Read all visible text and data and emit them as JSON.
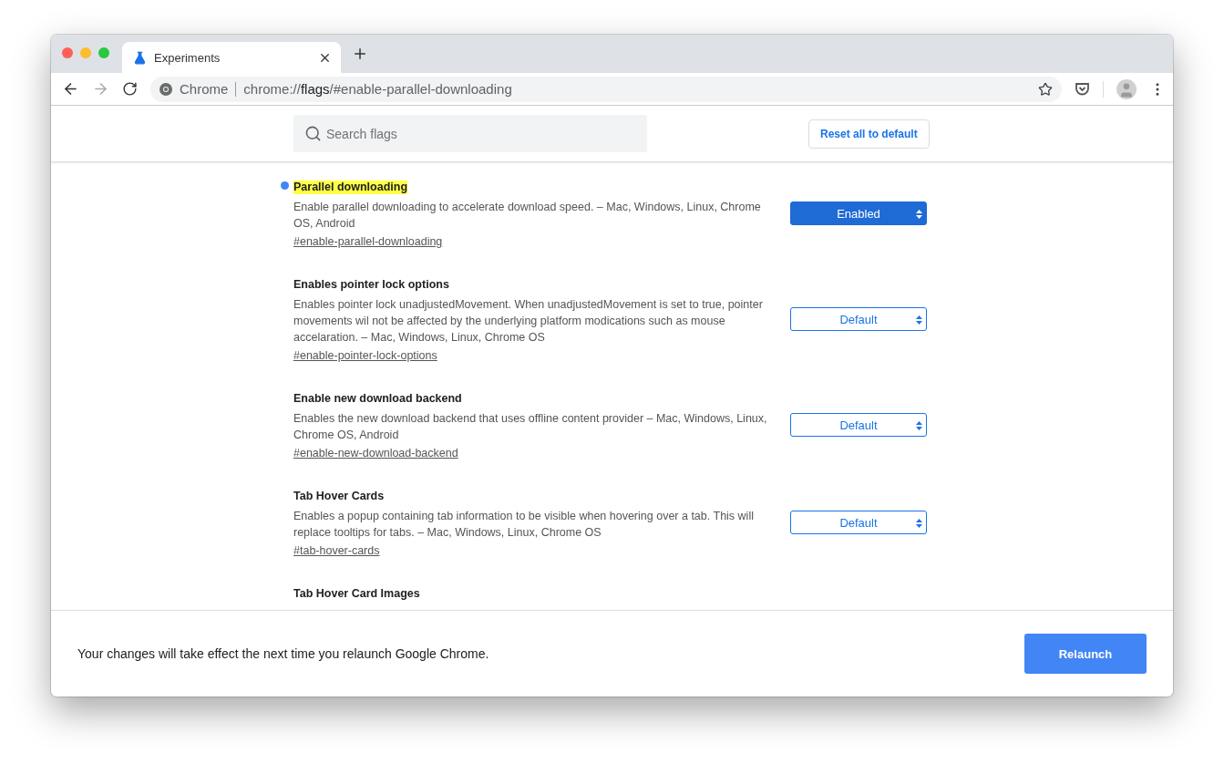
{
  "tab": {
    "title": "Experiments"
  },
  "address": {
    "site": "Chrome",
    "url_prefix": "chrome://",
    "url_host": "flags",
    "url_rest": "/#enable-parallel-downloading"
  },
  "search": {
    "placeholder": "Search flags"
  },
  "reset_button": "Reset all to default",
  "flags": [
    {
      "title": "Parallel downloading",
      "modified": true,
      "description": "Enable parallel downloading to accelerate download speed. – Mac, Windows, Linux, Chrome OS, Android",
      "link": "#enable-parallel-downloading",
      "value": "Enabled"
    },
    {
      "title": "Enables pointer lock options",
      "modified": false,
      "description": "Enables pointer lock unadjustedMovement. When unadjustedMovement is set to true, pointer movements wil not be affected by the underlying platform modications such as mouse accelaration. – Mac, Windows, Linux, Chrome OS",
      "link": "#enable-pointer-lock-options",
      "value": "Default"
    },
    {
      "title": "Enable new download backend",
      "modified": false,
      "description": "Enables the new download backend that uses offline content provider – Mac, Windows, Linux, Chrome OS, Android",
      "link": "#enable-new-download-backend",
      "value": "Default"
    },
    {
      "title": "Tab Hover Cards",
      "modified": false,
      "description": "Enables a popup containing tab information to be visible when hovering over a tab. This will replace tooltips for tabs. – Mac, Windows, Linux, Chrome OS",
      "link": "#tab-hover-cards",
      "value": "Default"
    },
    {
      "title": "Tab Hover Card Images",
      "modified": false
    }
  ],
  "footer": {
    "message": "Your changes will take effect the next time you relaunch Google Chrome.",
    "button": "Relaunch"
  }
}
